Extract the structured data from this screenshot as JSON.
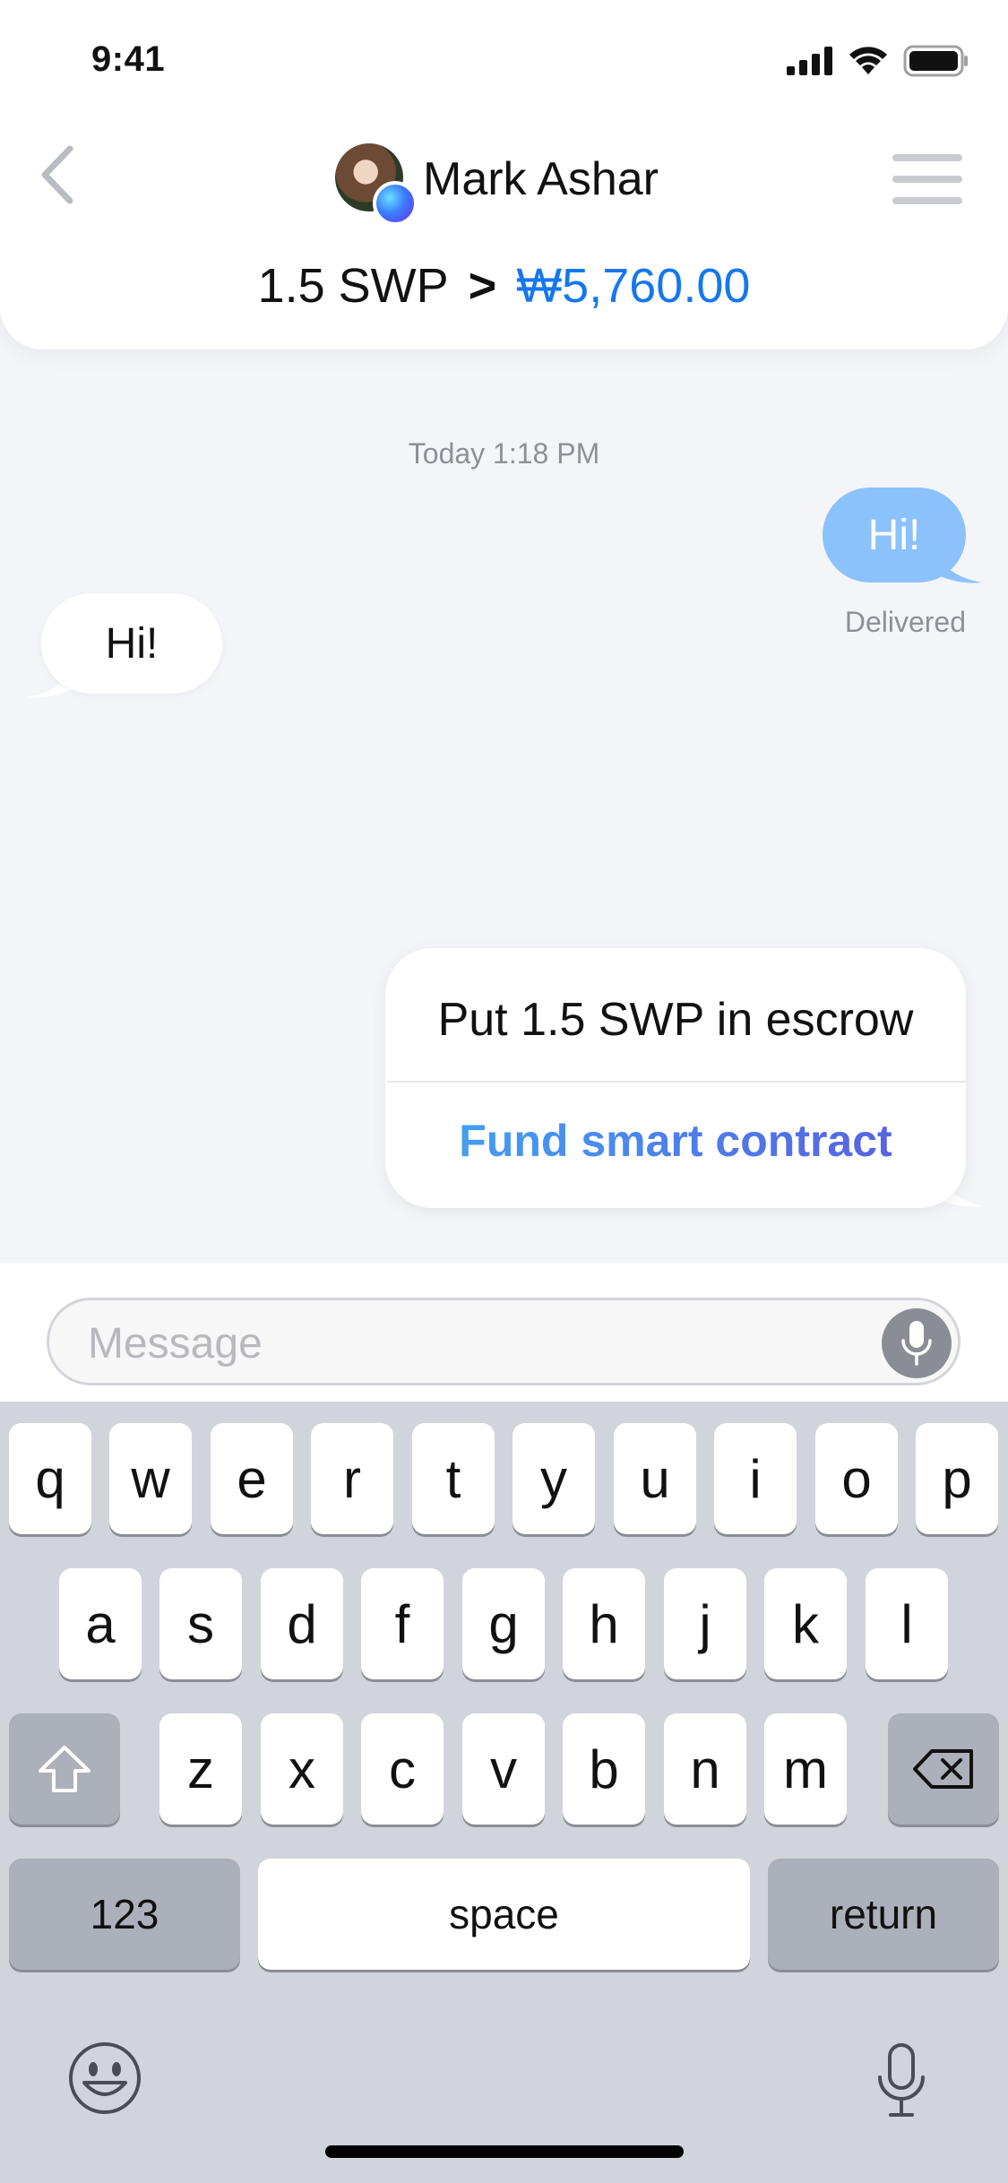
{
  "status_bar": {
    "time": "9:41"
  },
  "header": {
    "contact_name": "Mark Ashar",
    "rate": {
      "amount": "1.5 SWP",
      "separator": ">",
      "converted": "₩5,760.00"
    }
  },
  "conversation": {
    "timestamp": "Today 1:18 PM",
    "outgoing": {
      "text": "Hi!",
      "status": "Delivered"
    },
    "incoming": {
      "text": "Hi!"
    },
    "contract_card": {
      "title": "Put 1.5 SWP in escrow",
      "action_label": "Fund smart contract"
    }
  },
  "composer": {
    "placeholder": "Message"
  },
  "keyboard": {
    "row1": [
      "q",
      "w",
      "e",
      "r",
      "t",
      "y",
      "u",
      "i",
      "o",
      "p"
    ],
    "row2": [
      "a",
      "s",
      "d",
      "f",
      "g",
      "h",
      "j",
      "k",
      "l"
    ],
    "row3": [
      "z",
      "x",
      "c",
      "v",
      "b",
      "n",
      "m"
    ],
    "numbers_label": "123",
    "space_label": "space",
    "return_label": "return"
  },
  "colors": {
    "accent_blue": "#1677ee",
    "outgoing_bubble": "#8cc2fc",
    "gradient_start": "#3fa9f5",
    "gradient_end": "#5b58e0"
  }
}
